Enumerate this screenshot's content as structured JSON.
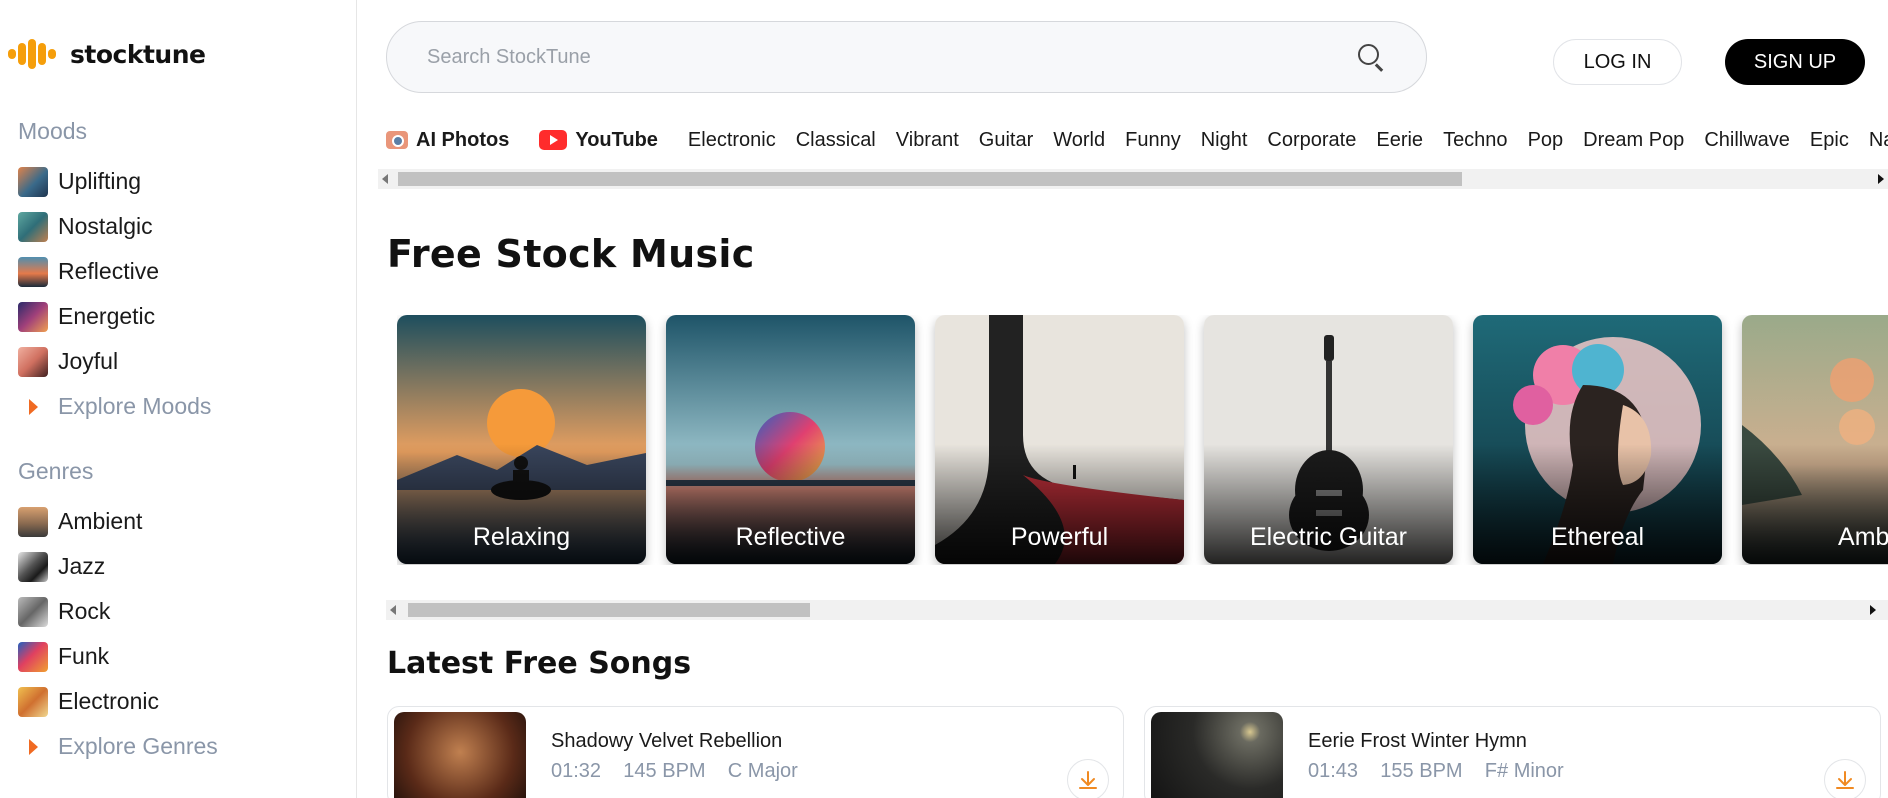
{
  "brand": {
    "name": "stocktune",
    "accent": "#f59e0b"
  },
  "search": {
    "placeholder": "Search StockTune"
  },
  "auth": {
    "login_label": "LOG IN",
    "signup_label": "SIGN UP"
  },
  "sidebar": {
    "moods_title": "Moods",
    "moods": [
      {
        "label": "Uplifting"
      },
      {
        "label": "Nostalgic"
      },
      {
        "label": "Reflective"
      },
      {
        "label": "Energetic"
      },
      {
        "label": "Joyful"
      }
    ],
    "explore_moods": "Explore Moods",
    "genres_title": "Genres",
    "genres": [
      {
        "label": "Ambient"
      },
      {
        "label": "Jazz"
      },
      {
        "label": "Rock"
      },
      {
        "label": "Funk"
      },
      {
        "label": "Electronic"
      }
    ],
    "explore_genres": "Explore Genres"
  },
  "categories": [
    {
      "label": "AI Photos",
      "icon": "camera-icon"
    },
    {
      "label": "YouTube",
      "icon": "youtube-icon"
    },
    {
      "label": "Electronic"
    },
    {
      "label": "Classical"
    },
    {
      "label": "Vibrant"
    },
    {
      "label": "Guitar"
    },
    {
      "label": "World"
    },
    {
      "label": "Funny"
    },
    {
      "label": "Night"
    },
    {
      "label": "Corporate"
    },
    {
      "label": "Eerie"
    },
    {
      "label": "Techno"
    },
    {
      "label": "Pop"
    },
    {
      "label": "Dream Pop"
    },
    {
      "label": "Chillwave"
    },
    {
      "label": "Epic"
    },
    {
      "label": "Nat"
    }
  ],
  "main": {
    "section_title": "Free Stock Music",
    "cards": [
      {
        "label": "Relaxing"
      },
      {
        "label": "Reflective"
      },
      {
        "label": "Powerful"
      },
      {
        "label": "Electric Guitar"
      },
      {
        "label": "Ethereal"
      },
      {
        "label": "Ambi"
      }
    ],
    "latest_title": "Latest Free Songs",
    "songs": [
      {
        "title": "Shadowy Velvet Rebellion",
        "duration": "01:32",
        "bpm": "145 BPM",
        "key": "C Major"
      },
      {
        "title": "Eerie Frost Winter Hymn",
        "duration": "01:43",
        "bpm": "155 BPM",
        "key": "F# Minor"
      }
    ]
  }
}
